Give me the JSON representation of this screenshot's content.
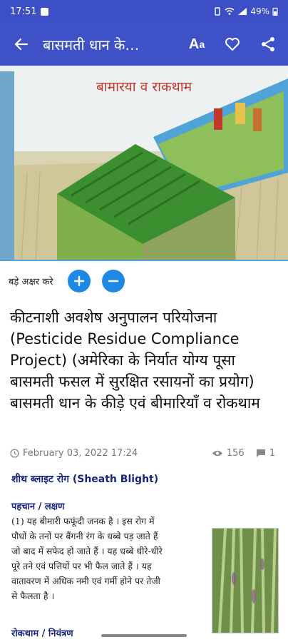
{
  "status": {
    "time": "17:51",
    "battery": "49%"
  },
  "appbar": {
    "title": "बासमती धान के…",
    "font_button": "A",
    "font_button_small": "a"
  },
  "hero": {
    "title": "बामारया व राकथाम"
  },
  "font_controls": {
    "label": "बड़े अक्षर करे"
  },
  "article": {
    "headline": "कीटनाशी अवशेष अनुपालन परियोजना (Pesticide Residue Compliance Project) (अमेरिका के निर्यात योग्य पूसा बासमती फसल में सुरक्षित रसायनों का प्रयोग) बासमती धान के कीड़े एवं बीमारियाँ व रोकथाम",
    "date": "February 03, 2022 17:24",
    "views": "156",
    "comments": "1",
    "section_title": "शीथ ब्लाइट रोग (Sheath Blight)",
    "sub_heading": "पहचान / लक्षण",
    "body_line1": "(1) यह बीमारी फफूंदी जनक है । इस रोग में",
    "body_line2": "पौधों के तनों पर बैंगनी रंग के धब्बे पड़ जाते हैं",
    "body_line3": "जो बाद में सफेद हो जाते हैं । यह धब्बे धीरे-धीरे",
    "body_line4": "पूरे तने एवं पत्तियों पर भी फैल जाते हैं । यह",
    "body_line5": "वातावरण में अधिक नमी एवं गर्मी होने पर तेजी",
    "body_line6": "से फैलता है ।",
    "next_heading": "रोकथाम / नियंत्रण"
  },
  "colors": {
    "appbar": "#3f51c6",
    "accent": "#1e88e5",
    "heading": "#1a237e"
  }
}
